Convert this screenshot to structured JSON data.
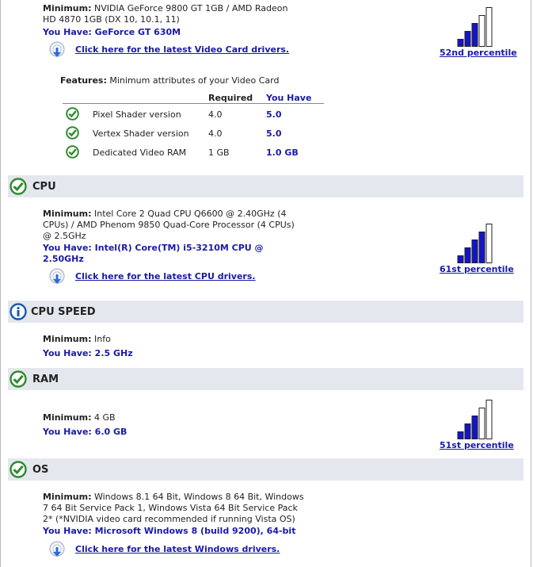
{
  "video_card": {
    "minimum_label": "Minimum:",
    "minimum_line1": "NVIDIA GeForce 9800 GT 1GB / AMD Radeon",
    "minimum_line2": "HD 4870 1GB (DX 10, 10.1, 11)",
    "you_have": "You Have: GeForce GT 630M",
    "driver_link": "Click here for the latest Video Card drivers.",
    "percentile": "52nd percentile",
    "percentile_fill": 3,
    "features_label": "Features:",
    "features_desc": "Minimum attributes of your Video Card",
    "table": {
      "col_required": "Required",
      "col_you_have": "You Have",
      "rows": [
        {
          "name": "Pixel Shader version",
          "required": "4.0",
          "you_have": "5.0"
        },
        {
          "name": "Vertex Shader version",
          "required": "4.0",
          "you_have": "5.0"
        },
        {
          "name": "Dedicated Video RAM",
          "required": "1 GB",
          "you_have": "1.0 GB"
        }
      ]
    }
  },
  "cpu": {
    "title": "CPU",
    "minimum_label": "Minimum:",
    "minimum_line1": "Intel Core 2 Quad CPU Q6600 @ 2.40GHz (4",
    "minimum_line2": "CPUs) / AMD Phenom 9850 Quad-Core Processor (4 CPUs)",
    "minimum_line3": "@ 2.5GHz",
    "you_have_line1": "You Have: Intel(R) Core(TM) i5-3210M CPU @",
    "you_have_line2": "2.50GHz",
    "driver_link": "Click here for the latest CPU drivers.",
    "percentile": "61st percentile",
    "percentile_fill": 4
  },
  "cpu_speed": {
    "title": "CPU SPEED",
    "minimum_label": "Minimum:",
    "minimum_value": "Info",
    "you_have": "You Have: 2.5 GHz"
  },
  "ram": {
    "title": "RAM",
    "minimum_label": "Minimum:",
    "minimum_value": "4 GB",
    "you_have": "You Have: 6.0 GB",
    "percentile": "51st percentile",
    "percentile_fill": 3
  },
  "os": {
    "title": "OS",
    "minimum_label": "Minimum:",
    "minimum_line1": "Windows 8.1 64 Bit, Windows 8 64 Bit, Windows",
    "minimum_line2": "7 64 Bit Service Pack 1, Windows Vista 64 Bit Service Pack",
    "minimum_line3": "2* (*NVIDIA video card recommended if running Vista OS)",
    "you_have": "You Have: Microsoft Windows 8 (build 9200), 64-bit",
    "driver_link": "Click here for the latest Windows drivers."
  },
  "colors": {
    "accent_blue": "#1a1aa8",
    "bar_fill": "#1414c8",
    "section_bg": "#e4e8ee",
    "check_green": "#2e8b2e",
    "info_blue": "#1a5aa8"
  }
}
